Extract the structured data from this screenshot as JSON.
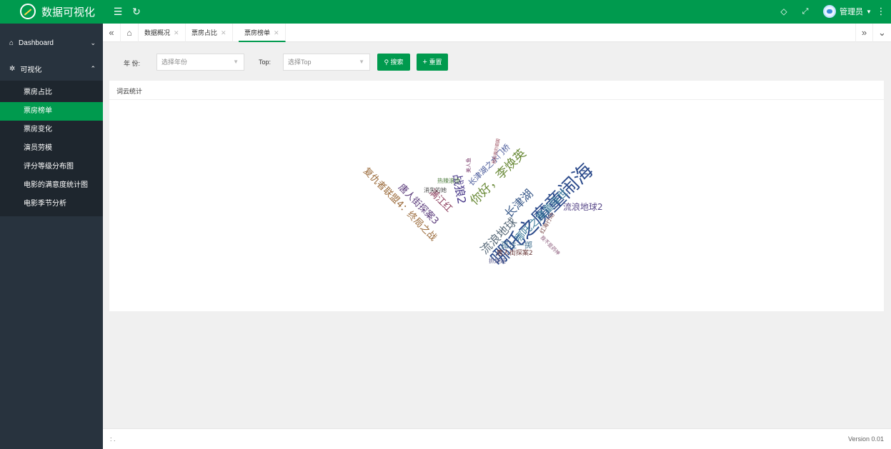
{
  "app": {
    "title": "数据可视化",
    "brand_color": "#009a4e",
    "sidebar_color": "#28333e"
  },
  "header": {
    "user_name": "管理员"
  },
  "sidebar": {
    "dashboard": "Dashboard",
    "group": "可视化",
    "items": [
      {
        "label": "票房占比",
        "active": false
      },
      {
        "label": "票房榜单",
        "active": true
      },
      {
        "label": "票房变化",
        "active": false
      },
      {
        "label": "演员劳模",
        "active": false
      },
      {
        "label": "评分等级分布图",
        "active": false
      },
      {
        "label": "电影的满意度统计图",
        "active": false
      },
      {
        "label": "电影季节分析",
        "active": false
      }
    ]
  },
  "tabs": [
    {
      "label": "数据概况"
    },
    {
      "label": "票房占比"
    },
    {
      "label": "票房榜单",
      "active": true
    }
  ],
  "search": {
    "year_label": "年  份:",
    "year_placeholder": "选择年份",
    "top_label": "Top:",
    "top_placeholder": "选择Top",
    "search_btn": "搜索",
    "reset_btn": "重置"
  },
  "card": {
    "title": "词云统计",
    "words": [
      {
        "text": "哪吒之魔童闹海",
        "color": "#2b4a8b"
      },
      {
        "text": "流浪地球",
        "color": "#5a6b7a"
      },
      {
        "text": "长津湖",
        "color": "#3a5a8a"
      },
      {
        "text": "你好，李焕英",
        "color": "#6b8b3a"
      },
      {
        "text": "战狼2",
        "color": "#4a3a8a"
      },
      {
        "text": "哪吒之魔童降世",
        "color": "#3a7a9a"
      },
      {
        "text": "复仇者联盟4：终局之战",
        "color": "#9a6a3a"
      },
      {
        "text": "唐人街探案3",
        "color": "#5a3a7a"
      },
      {
        "text": "满江红",
        "color": "#8a3a5a"
      },
      {
        "text": "长津湖之水门桥",
        "color": "#4a5a9a"
      },
      {
        "text": "流浪地球2",
        "color": "#5a4a8a"
      },
      {
        "text": "孤注一掷",
        "color": "#3a6a8a"
      },
      {
        "text": "唐人街探案2",
        "color": "#6a3a3a"
      },
      {
        "text": "红海行动",
        "color": "#7a4a4a"
      },
      {
        "text": "消失的她",
        "color": "#4a4a4a"
      },
      {
        "text": "热辣滚烫",
        "color": "#4a7a3a"
      },
      {
        "text": "美人鱼",
        "color": "#7a3a6a"
      },
      {
        "text": "我和我的祖国",
        "color": "#9a4a5a"
      },
      {
        "text": "我不是药神",
        "color": "#8a5a7a"
      },
      {
        "text": "抓娃娃",
        "color": "#5a5a8a"
      }
    ]
  },
  "footer": {
    "left": ": .",
    "right": "Version 0.01"
  }
}
